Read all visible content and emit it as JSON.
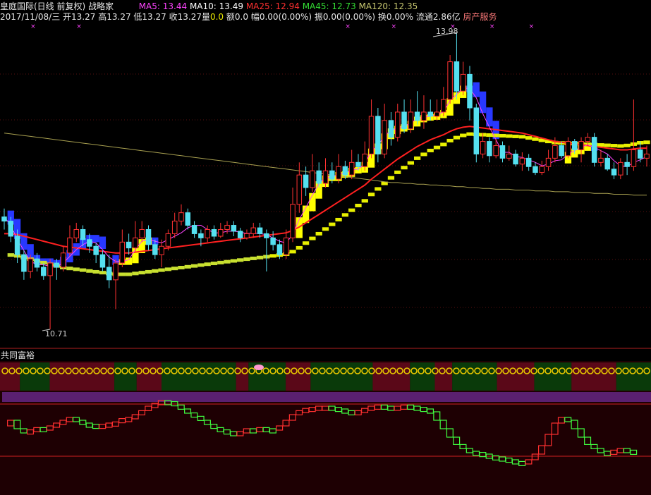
{
  "header": {
    "name": "皇庭国际(日线 前复权)",
    "indicator": "战略家",
    "ma": [
      {
        "label": "MA5: 13.44",
        "color": "#ff44ff"
      },
      {
        "label": "MA10: 13.49",
        "color": "#ffffff"
      },
      {
        "label": "MA25: 12.94",
        "color": "#ff3030"
      },
      {
        "label": "MA45: 12.73",
        "color": "#33dd33"
      },
      {
        "label": "MA120: 12.35",
        "color": "#c8c870"
      }
    ],
    "date": "2017/11/08/三",
    "open": "开13.27",
    "high": "高13.27",
    "low": "低13.27",
    "close": "收13.27",
    "vol_label": "量",
    "vol_value": "0.0",
    "amount": "额0.0",
    "change": "幅0.00(0.00%)",
    "amplitude": "振0.00(0.00%)",
    "turnover": "换0.00%",
    "float": "流通2.86亿",
    "sector": "房产服务"
  },
  "annotations": {
    "high_label": "13.98",
    "low_label": "10.71"
  },
  "sub_panel": {
    "title": "共同富裕"
  },
  "colors": {
    "up": "#ff3232",
    "down": "#55e0f0",
    "yellow_band": "#ffff00",
    "blue_band": "#2838ff",
    "ma5": "#ff44ff",
    "ma10": "#e0e0ff",
    "ma25": "#ff2020",
    "ma45": "#ccff44",
    "ma120": "#a8a050",
    "osc_up": "#ff3030",
    "osc_down": "#40ff40",
    "coin": "#e8c800",
    "state_green": "#0a3a0a",
    "state_red": "#5a0818",
    "purple_band": "#5a2070"
  },
  "chart_data": {
    "type": "candlestick",
    "title": "皇庭国际(日线 前复权)",
    "annotated_high": 13.98,
    "annotated_low": 10.71,
    "ylim": [
      10.5,
      14.3
    ],
    "candles": [
      [
        12.05,
        12.0,
        12.15,
        11.9
      ],
      [
        12.0,
        11.82,
        12.05,
        11.75
      ],
      [
        11.82,
        11.6,
        11.9,
        11.5
      ],
      [
        11.6,
        11.4,
        11.65,
        11.3
      ],
      [
        11.4,
        11.55,
        11.6,
        11.32
      ],
      [
        11.55,
        11.45,
        11.62,
        11.4
      ],
      [
        11.45,
        11.35,
        11.5,
        11.3
      ],
      [
        11.35,
        11.5,
        11.55,
        10.71
      ],
      [
        11.5,
        11.45,
        11.55,
        11.3
      ],
      [
        11.45,
        11.62,
        11.7,
        11.4
      ],
      [
        11.62,
        11.8,
        11.95,
        11.58
      ],
      [
        11.8,
        11.9,
        11.98,
        11.75
      ],
      [
        11.9,
        11.78,
        11.95,
        11.7
      ],
      [
        11.78,
        11.7,
        11.85,
        11.62
      ],
      [
        11.7,
        11.6,
        11.74,
        11.5
      ],
      [
        11.6,
        11.45,
        11.65,
        11.4
      ],
      [
        11.45,
        11.3,
        11.6,
        11.2
      ],
      [
        11.3,
        11.5,
        11.55,
        10.95
      ],
      [
        11.5,
        11.75,
        11.9,
        11.45
      ],
      [
        11.75,
        11.68,
        11.85,
        11.6
      ],
      [
        11.68,
        11.8,
        12.0,
        11.62
      ],
      [
        11.8,
        11.9,
        12.0,
        11.75
      ],
      [
        11.9,
        11.72,
        11.95,
        11.65
      ],
      [
        11.72,
        11.6,
        11.78,
        11.55
      ],
      [
        11.6,
        11.7,
        11.78,
        11.45
      ],
      [
        11.7,
        11.85,
        11.9,
        11.65
      ],
      [
        11.85,
        12.0,
        12.1,
        11.8
      ],
      [
        12.0,
        12.1,
        12.2,
        11.95
      ],
      [
        12.1,
        11.95,
        12.15,
        11.9
      ],
      [
        11.95,
        11.85,
        12.0,
        11.8
      ],
      [
        11.85,
        11.8,
        11.9,
        11.7
      ],
      [
        11.8,
        11.9,
        11.95,
        11.75
      ],
      [
        11.9,
        11.82,
        11.95,
        11.78
      ],
      [
        11.82,
        11.9,
        11.98,
        11.8
      ],
      [
        11.9,
        11.95,
        12.0,
        11.85
      ],
      [
        11.95,
        11.88,
        12.0,
        11.82
      ],
      [
        11.88,
        11.8,
        11.92,
        11.75
      ],
      [
        11.8,
        11.85,
        11.9,
        11.78
      ],
      [
        11.85,
        11.92,
        11.98,
        11.8
      ],
      [
        11.92,
        11.85,
        11.98,
        11.8
      ],
      [
        11.85,
        11.8,
        11.9,
        11.4
      ],
      [
        11.8,
        11.72,
        11.88,
        11.65
      ],
      [
        11.72,
        11.6,
        11.78,
        11.55
      ],
      [
        11.6,
        11.8,
        11.9,
        11.55
      ],
      [
        11.8,
        12.2,
        12.4,
        11.75
      ],
      [
        12.2,
        12.55,
        12.7,
        12.1
      ],
      [
        12.55,
        12.4,
        12.65,
        12.3
      ],
      [
        12.4,
        12.6,
        12.8,
        12.35
      ],
      [
        12.6,
        12.45,
        12.7,
        12.4
      ],
      [
        12.45,
        12.6,
        12.75,
        12.4
      ],
      [
        12.6,
        12.5,
        12.7,
        12.45
      ],
      [
        12.5,
        12.65,
        12.8,
        12.45
      ],
      [
        12.65,
        12.55,
        12.72,
        12.5
      ],
      [
        12.55,
        12.7,
        12.85,
        12.5
      ],
      [
        12.7,
        12.65,
        12.8,
        12.6
      ],
      [
        12.65,
        12.8,
        12.95,
        12.6
      ],
      [
        12.8,
        13.25,
        13.45,
        12.75
      ],
      [
        13.25,
        12.8,
        13.35,
        12.7
      ],
      [
        12.8,
        13.2,
        13.4,
        12.75
      ],
      [
        13.2,
        13.0,
        13.3,
        12.9
      ],
      [
        13.0,
        13.3,
        13.4,
        12.95
      ],
      [
        13.3,
        13.1,
        13.45,
        13.05
      ],
      [
        13.1,
        13.3,
        13.45,
        13.05
      ],
      [
        13.3,
        13.2,
        13.55,
        13.15
      ],
      [
        13.2,
        13.3,
        13.5,
        13.1
      ],
      [
        13.3,
        13.25,
        13.45,
        13.2
      ],
      [
        13.25,
        13.3,
        13.45,
        13.2
      ],
      [
        13.3,
        13.45,
        13.6,
        13.25
      ],
      [
        13.45,
        13.9,
        13.98,
        13.4
      ],
      [
        13.9,
        13.55,
        14.25,
        13.45
      ],
      [
        13.55,
        13.75,
        13.9,
        13.5
      ],
      [
        13.75,
        13.35,
        13.85,
        13.2
      ],
      [
        13.35,
        12.8,
        13.4,
        12.7
      ],
      [
        12.8,
        12.95,
        13.05,
        12.75
      ],
      [
        12.95,
        12.78,
        13.0,
        12.7
      ],
      [
        12.78,
        12.9,
        12.98,
        12.75
      ],
      [
        12.9,
        12.75,
        12.95,
        12.7
      ],
      [
        12.75,
        12.8,
        12.9,
        12.72
      ],
      [
        12.8,
        12.68,
        12.85,
        12.65
      ],
      [
        12.68,
        12.75,
        12.82,
        12.6
      ],
      [
        12.75,
        12.65,
        12.8,
        12.6
      ],
      [
        12.65,
        12.58,
        12.7,
        12.55
      ],
      [
        12.58,
        12.65,
        12.72,
        12.55
      ],
      [
        12.65,
        12.75,
        12.85,
        12.6
      ],
      [
        12.75,
        12.9,
        13.0,
        12.7
      ],
      [
        12.9,
        12.78,
        12.95,
        12.75
      ],
      [
        12.78,
        12.95,
        13.0,
        12.75
      ],
      [
        12.95,
        12.85,
        12.98,
        12.8
      ],
      [
        12.85,
        12.95,
        13.0,
        12.7
      ],
      [
        12.95,
        13.0,
        13.05,
        12.9
      ],
      [
        13.0,
        12.7,
        13.05,
        12.65
      ],
      [
        12.7,
        12.75,
        12.85,
        12.65
      ],
      [
        12.75,
        12.62,
        12.8,
        12.6
      ],
      [
        12.62,
        12.55,
        12.7,
        12.5
      ],
      [
        12.55,
        12.7,
        12.75,
        12.5
      ],
      [
        12.7,
        12.65,
        12.8,
        12.55
      ],
      [
        12.65,
        12.85,
        13.45,
        12.6
      ],
      [
        12.85,
        12.75,
        12.95,
        12.7
      ],
      [
        12.75,
        12.8,
        12.9,
        12.65
      ]
    ],
    "ma5": [
      12.05,
      11.95,
      11.78,
      11.65,
      11.52,
      11.48,
      11.48,
      11.46,
      11.46,
      11.5,
      11.58,
      11.66,
      11.72,
      11.76,
      11.74,
      11.66,
      11.57,
      11.52,
      11.52,
      11.54,
      11.66,
      11.76,
      11.78,
      11.76,
      11.74,
      11.78,
      11.82,
      11.86,
      11.92,
      11.95,
      11.95,
      11.9,
      11.86,
      11.86,
      11.88,
      11.88,
      11.87,
      11.85,
      11.86,
      11.85,
      11.84,
      11.8,
      11.76,
      11.74,
      11.84,
      12.02,
      12.16,
      12.31,
      12.45,
      12.52,
      12.52,
      12.56,
      12.57,
      12.61,
      12.62,
      12.68,
      12.84,
      12.9,
      13.02,
      13.08,
      13.11,
      13.13,
      13.17,
      13.22,
      13.24,
      13.25,
      13.27,
      13.3,
      13.44,
      13.51,
      13.59,
      13.58,
      13.47,
      13.28,
      13.12,
      12.97,
      12.82,
      12.82,
      12.77,
      12.76,
      12.73,
      12.7,
      12.66,
      12.68,
      12.72,
      12.73,
      12.8,
      12.84,
      12.88,
      12.91,
      12.88,
      12.84,
      12.8,
      12.72,
      12.66,
      12.65,
      12.7,
      12.73,
      12.77
    ],
    "ma25": [
      11.85,
      11.85,
      11.84,
      11.82,
      11.8,
      11.78,
      11.76,
      11.74,
      11.72,
      11.7,
      11.69,
      11.68,
      11.67,
      11.66,
      11.65,
      11.64,
      11.63,
      11.62,
      11.62,
      11.62,
      11.63,
      11.64,
      11.65,
      11.66,
      11.67,
      11.68,
      11.69,
      11.7,
      11.71,
      11.72,
      11.73,
      11.74,
      11.75,
      11.76,
      11.77,
      11.78,
      11.79,
      11.8,
      11.81,
      11.82,
      11.83,
      11.84,
      11.85,
      11.86,
      11.89,
      11.93,
      11.98,
      12.03,
      12.08,
      12.13,
      12.18,
      12.23,
      12.28,
      12.33,
      12.38,
      12.43,
      12.5,
      12.56,
      12.62,
      12.68,
      12.74,
      12.79,
      12.84,
      12.89,
      12.93,
      12.97,
      13.0,
      13.03,
      13.07,
      13.1,
      13.12,
      13.13,
      13.12,
      13.11,
      13.1,
      13.09,
      13.08,
      13.07,
      13.06,
      13.05,
      13.03,
      13.01,
      12.99,
      12.97,
      12.95,
      12.94,
      12.93,
      12.92,
      12.91,
      12.9,
      12.89,
      12.88,
      12.87,
      12.86,
      12.85,
      12.85,
      12.86,
      12.87,
      12.87
    ],
    "ma120": [
      13.05,
      13.04,
      13.03,
      13.02,
      13.01,
      13.0,
      12.99,
      12.98,
      12.97,
      12.96,
      12.95,
      12.94,
      12.93,
      12.92,
      12.91,
      12.9,
      12.89,
      12.88,
      12.87,
      12.86,
      12.85,
      12.84,
      12.83,
      12.82,
      12.81,
      12.8,
      12.79,
      12.78,
      12.77,
      12.76,
      12.75,
      12.74,
      12.73,
      12.72,
      12.71,
      12.7,
      12.69,
      12.68,
      12.67,
      12.66,
      12.65,
      12.64,
      12.63,
      12.62,
      12.61,
      12.6,
      12.59,
      12.58,
      12.57,
      12.56,
      12.55,
      12.54,
      12.53,
      12.52,
      12.51,
      12.5,
      12.49,
      12.48,
      12.47,
      12.46,
      12.46,
      12.45,
      12.45,
      12.44,
      12.44,
      12.43,
      12.43,
      12.42,
      12.42,
      12.41,
      12.41,
      12.4,
      12.4,
      12.39,
      12.39,
      12.38,
      12.38,
      12.38,
      12.37,
      12.37,
      12.37,
      12.36,
      12.36,
      12.36,
      12.35,
      12.35,
      12.35,
      12.34,
      12.34,
      12.34,
      12.33,
      12.33,
      12.33,
      12.32,
      12.32,
      12.32,
      12.31,
      12.31,
      12.31
    ],
    "oscillator": [
      0.45,
      0.55,
      0.4,
      0.35,
      0.38,
      0.42,
      0.4,
      0.45,
      0.5,
      0.55,
      0.6,
      0.55,
      0.5,
      0.48,
      0.45,
      0.48,
      0.5,
      0.52,
      0.58,
      0.6,
      0.65,
      0.72,
      0.8,
      0.85,
      0.9,
      0.88,
      0.82,
      0.75,
      0.68,
      0.62,
      0.55,
      0.48,
      0.42,
      0.38,
      0.35,
      0.32,
      0.35,
      0.4,
      0.38,
      0.42,
      0.4,
      0.38,
      0.45,
      0.55,
      0.65,
      0.72,
      0.76,
      0.78,
      0.8,
      0.8,
      0.78,
      0.75,
      0.72,
      0.7,
      0.72,
      0.76,
      0.8,
      0.82,
      0.8,
      0.78,
      0.8,
      0.82,
      0.8,
      0.78,
      0.75,
      0.7,
      0.55,
      0.4,
      0.25,
      0.12,
      0.05,
      0.0,
      -0.02,
      -0.05,
      -0.08,
      -0.1,
      -0.12,
      -0.15,
      -0.18,
      -0.2,
      -0.15,
      -0.05,
      0.1,
      0.3,
      0.5,
      0.6,
      0.55,
      0.4,
      0.25,
      0.12,
      0.05,
      0.0,
      -0.02,
      0.02,
      0.05,
      0.02,
      0.0
    ]
  }
}
